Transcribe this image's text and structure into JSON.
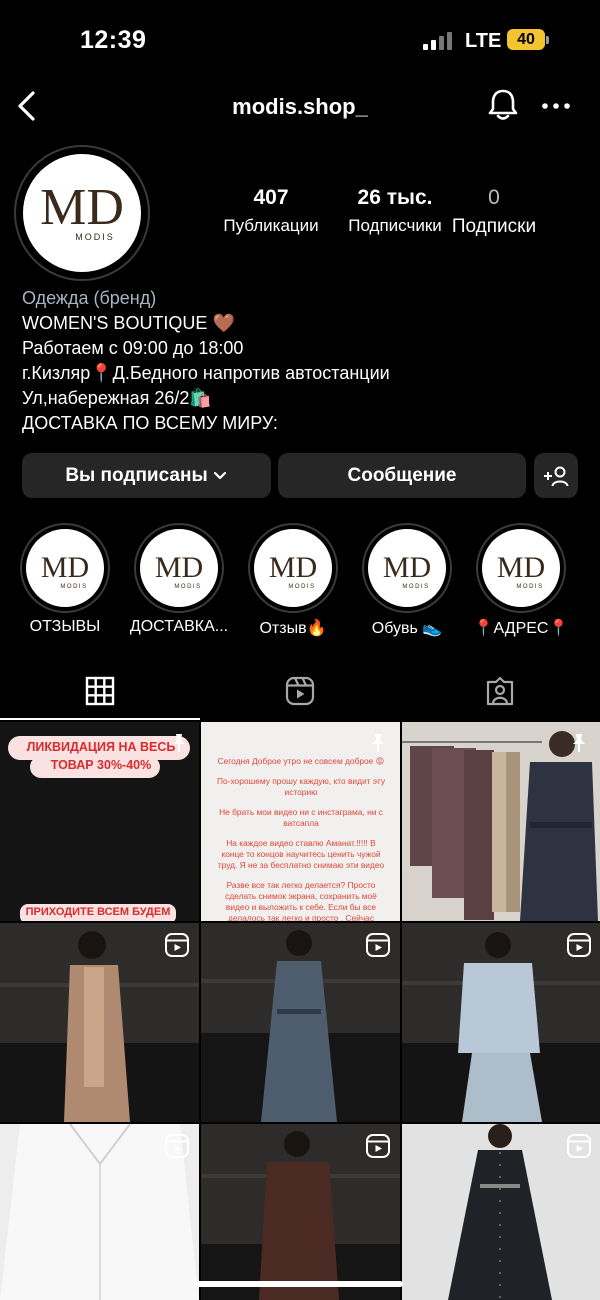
{
  "status": {
    "time": "12:39",
    "carrier": "LTE",
    "battery": "40"
  },
  "header": {
    "username": "modis.shop_"
  },
  "avatar": {
    "logo_letters": "MD",
    "logo_word": "MODIS"
  },
  "stats": [
    {
      "value": "407",
      "label": "Публикации"
    },
    {
      "value": "26 тыс.",
      "label": "Подписчики"
    },
    {
      "value": "0",
      "label": "Подписки"
    }
  ],
  "bio": {
    "category": "Одежда (бренд)",
    "lines": [
      "WOMEN'S BOUTIQUE 🤎",
      "Работаем с 09:00 до 18:00",
      "г.Кизляр📍Д.Бедного напротив автостанции",
      "Ул,набережная 26/2🛍️",
      "ДОСТАВКА ПО ВСЕМУ МИРУ:"
    ]
  },
  "buttons": {
    "following": "Вы подписаны",
    "message": "Сообщение"
  },
  "highlights": [
    {
      "label": "ОТЗЫВЫ"
    },
    {
      "label": "ДОСТАВКА..."
    },
    {
      "label": "Отзыв🔥"
    },
    {
      "label": "Обувь 👟"
    },
    {
      "label": "📍АДРЕС📍"
    }
  ],
  "posts": {
    "post1": {
      "banner_top": "ЛИКВИДАЦИЯ НА ВЕСЬ ТОВАР 30%-40%",
      "banner_bottom": "ПРИХОДИТЕ ВСЕМ БУДЕМ"
    },
    "post2": {
      "paragraphs": [
        "Сегодня Доброе утро не совсем доброе 😡",
        "По-хорошему прошу каждую, кто видит эту историю",
        "Не брать мои видео ни с инстаграма, ни с ватсапла",
        "На каждое видео ставлю Аманат.!!!!! В конце то концов научитесь ценить чужой труд. Я не за бесплатно снимаю эти видео",
        "Разве все так легко делается? Просто сделать снимок экрана, сохранить моё видео и выложить к себе. Если бы все делалось так легко и просто , Сейчас инстаграмм так не развивался бы !!!!"
      ]
    }
  },
  "colors": {
    "background": "#000000",
    "button_bg": "#262626",
    "category_text": "#a8b4c4",
    "battery": "#f4c430",
    "banner_text": "#d92b2b",
    "story_red": "#e0463a"
  }
}
